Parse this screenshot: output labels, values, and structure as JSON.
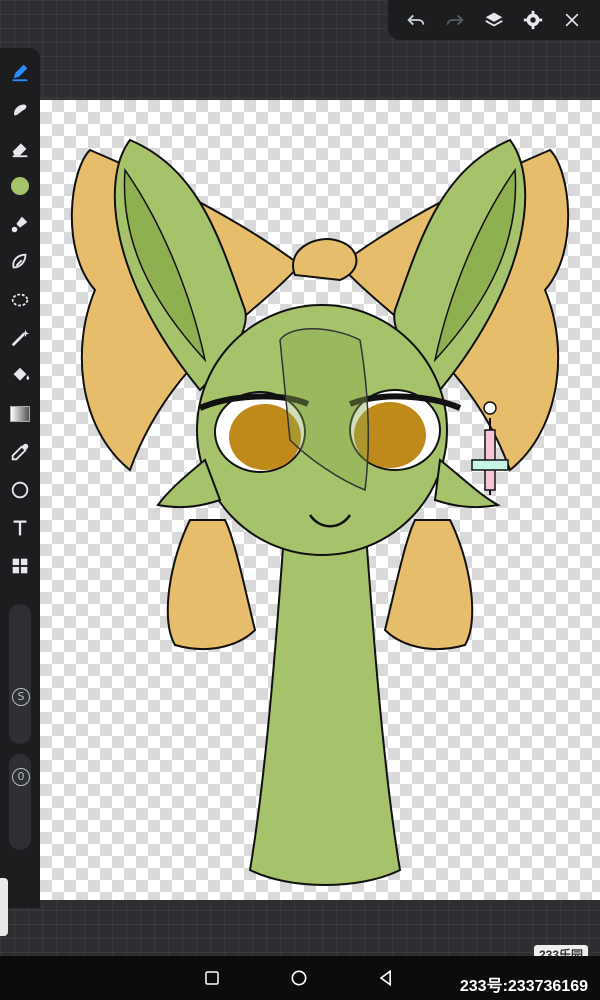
{
  "top_toolbar": {
    "icons": [
      "undo-icon",
      "redo-icon",
      "layers-icon",
      "settings-icon",
      "close-icon"
    ]
  },
  "sidebar": {
    "tools": [
      "pen-icon",
      "smudge-icon",
      "eraser-icon",
      "color-swatch",
      "brush-icon",
      "lasso-icon",
      "select-icon",
      "magic-wand-icon",
      "fill-icon",
      "gradient-icon",
      "eyedropper-icon",
      "shape-icon",
      "text-icon",
      "grid-icon"
    ],
    "active_color": "#a6c26a",
    "size_label": "S",
    "opacity_label": "0"
  },
  "navbar": {
    "icons": [
      "recents-icon",
      "home-icon",
      "back-icon"
    ]
  },
  "watermark": {
    "logo_text": "233乐园",
    "id_text": "233号:233736169"
  },
  "colors": {
    "accent": "#2d8cff",
    "character_green": "#a6c26a",
    "bow_yellow": "#e6bd6a",
    "eye_amber": "#c08a1a"
  }
}
